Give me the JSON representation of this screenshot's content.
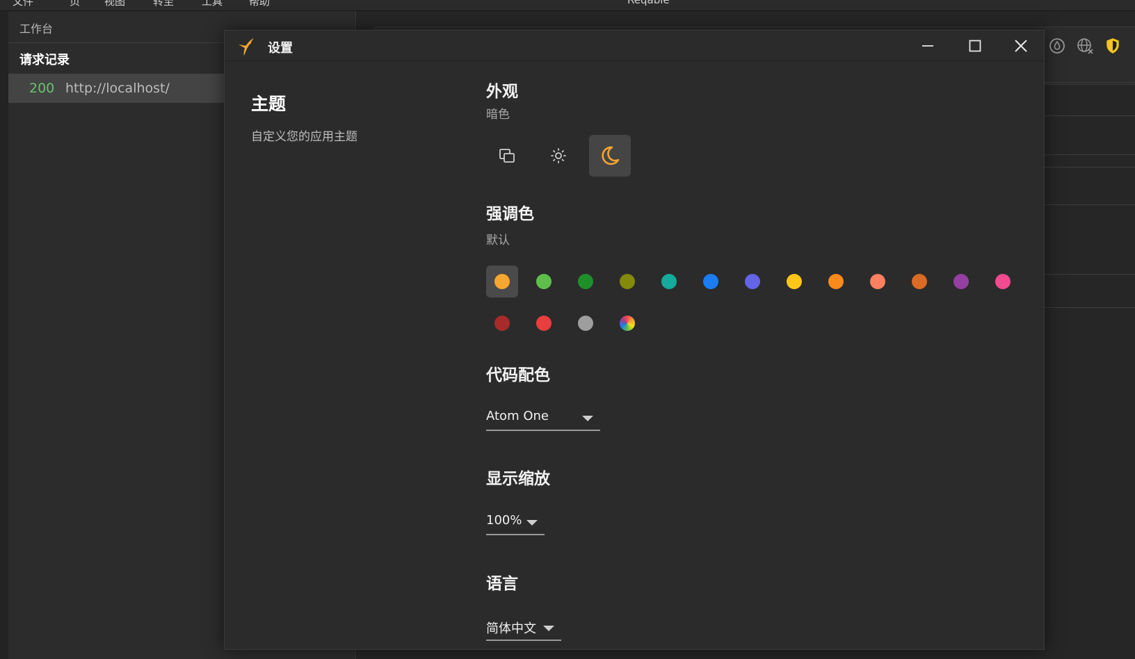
{
  "background": {
    "menubar": {
      "items": [
        "文件",
        "页",
        "视图",
        "转至",
        "工具",
        "帮助"
      ],
      "title": "Reqable"
    },
    "left_pane": {
      "workbench_label": "工作台",
      "history_title": "请求记录",
      "history_items": [
        {
          "status": "200",
          "url": "http://localhost/"
        }
      ]
    },
    "toolbar_icons": [
      "water-drop-icon",
      "globe-icon",
      "shield-icon"
    ]
  },
  "dialog": {
    "title": "设置",
    "window_buttons": [
      "minimize-icon",
      "maximize-icon",
      "close-icon"
    ],
    "section": {
      "title": "主题",
      "description": "自定义您的应用主题"
    },
    "appearance": {
      "title": "外观",
      "current": "暗色",
      "modes": [
        {
          "name": "system",
          "icon": "system-mode-icon",
          "active": false
        },
        {
          "name": "light",
          "icon": "sun-icon",
          "active": false
        },
        {
          "name": "dark",
          "icon": "moon-icon",
          "active": true
        }
      ]
    },
    "accent": {
      "title": "强调色",
      "current": "默认",
      "selected_index": 0,
      "colors": [
        "#f7a630",
        "#5fbe4b",
        "#1f8f2a",
        "#848a09",
        "#14ab9c",
        "#1a7df2",
        "#6464e6",
        "#ffc619",
        "#fa8a1c",
        "#fa8060",
        "#d96b24",
        "#943fa1",
        "#f24a8f",
        "#a82b2b",
        "#e83e3e",
        "#9e9e9e",
        "multicolor"
      ]
    },
    "code_theme": {
      "title": "代码配色",
      "value": "Atom One"
    },
    "zoom": {
      "title": "显示缩放",
      "value": "100%"
    },
    "language": {
      "title": "语言",
      "value": "简体中文"
    }
  }
}
